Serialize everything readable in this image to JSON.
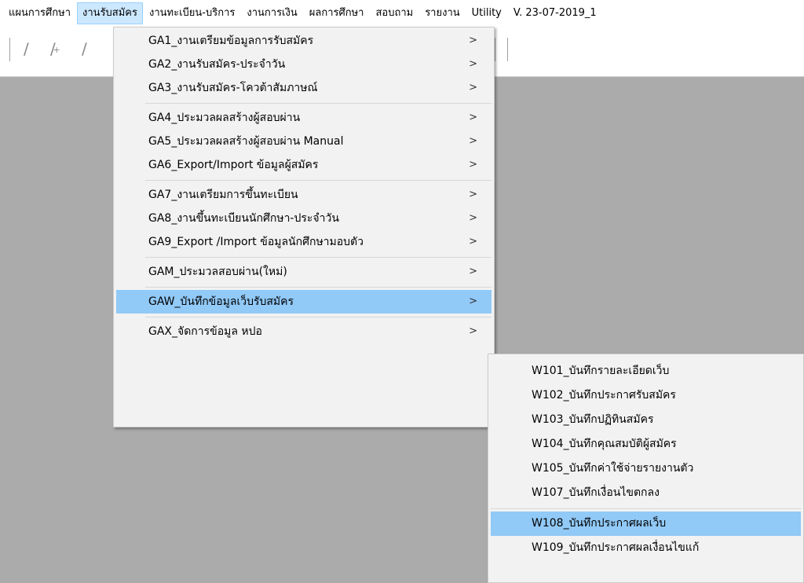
{
  "menubar": {
    "items": [
      "แผนการศึกษา",
      "งานรับสมัคร",
      "งานทะเบียน-บริการ",
      "งานการเงิน",
      "ผลการศึกษา",
      "สอบถาม",
      "รายงาน",
      "Utility",
      "V. 23-07-2019_1"
    ],
    "active_index": 1
  },
  "toolbar": {
    "icons": [
      "pencil-icon",
      "pencil-add-icon",
      "pencil-icon"
    ]
  },
  "main_menu": {
    "items": [
      {
        "label": "GA1_งานเตรียมข้อมูลการรับสมัคร",
        "arrow": ">"
      },
      {
        "label": "GA2_งานรับสมัคร-ประจำวัน",
        "arrow": ">"
      },
      {
        "label": "GA3_งานรับสมัคร-โควต้าสัมภาษณ์",
        "arrow": ">"
      },
      {
        "label": "GA4_ประมวลผลสร้างผู้สอบผ่าน",
        "arrow": ">"
      },
      {
        "label": "GA5_ประมวลผลสร้างผู้สอบผ่าน Manual",
        "arrow": ">"
      },
      {
        "label": "GA6_Export/Import ข้อมูลผู้สมัคร",
        "arrow": ">"
      },
      {
        "label": "GA7_งานเตรียมการขึ้นทะเบียน",
        "arrow": ">"
      },
      {
        "label": "GA8_งานขึ้นทะเบียนนักศึกษา-ประจำวัน",
        "arrow": ">"
      },
      {
        "label": "GA9_Export /Import ข้อมูลนักศึกษามอบตัว",
        "arrow": ">"
      },
      {
        "label": "GAM_ประมวลสอบผ่าน(ใหม่)",
        "arrow": ">"
      },
      {
        "label": "GAW_บันทึกข้อมูลเว็บรับสมัคร",
        "arrow": ">"
      },
      {
        "label": "GAX_จัดการข้อมูล หปอ",
        "arrow": ">"
      }
    ],
    "highlighted_index": 10
  },
  "sub_menu": {
    "items": [
      {
        "label": "W101_บันทึกรายละเอียดเว็บ"
      },
      {
        "label": "W102_บันทึกประกาศรับสมัคร"
      },
      {
        "label": "W103_บันทึกปฏิทินสมัคร"
      },
      {
        "label": "W104_บันทึกคุณสมบัติผู้สมัคร"
      },
      {
        "label": "W105_บันทึกค่าใช้จ่ายรายงานตัว"
      },
      {
        "label": "W107_บันทึกเงื่อนไขตกลง"
      },
      {
        "label": "W108_บันทึกประกาศผลเว็บ"
      },
      {
        "label": "W109_บันทึกประกาศผลเงื่อนไขแก้"
      }
    ],
    "highlighted_index": 6
  },
  "colors": {
    "menu_highlight": "#91c9f7",
    "menubar_active": "#cce8ff",
    "background": "#ababab"
  }
}
